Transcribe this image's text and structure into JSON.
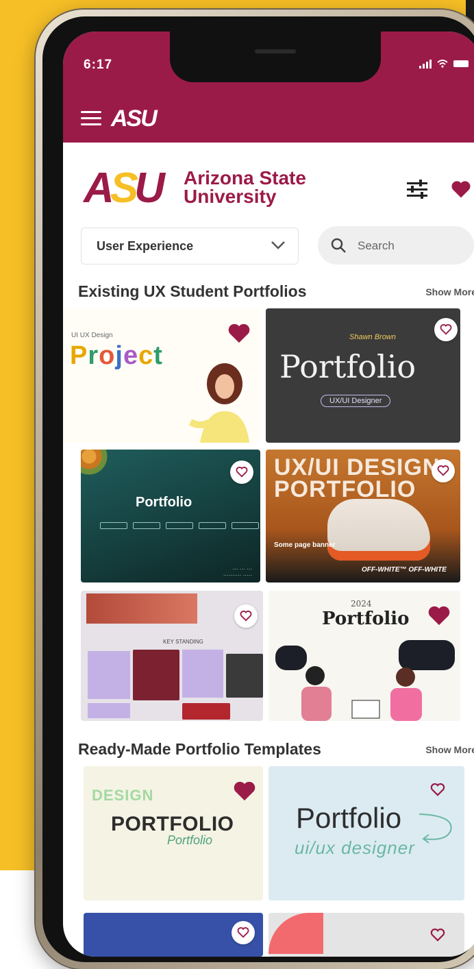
{
  "status": {
    "time": "6:17"
  },
  "appbar": {
    "logo": "ASU"
  },
  "brand": {
    "logo_asu_a": "A",
    "logo_asu_s": "S",
    "logo_asu_u": "U",
    "name_line1": "Arizona State",
    "name_line2": "University"
  },
  "controls": {
    "dropdown_value": "User Experience",
    "search_placeholder": "Search"
  },
  "sections": [
    {
      "title": "Existing UX Student Portfolios",
      "more": "Show More"
    },
    {
      "title": "Ready-Made Portfolio Templates",
      "more": "Show More"
    }
  ],
  "cards": {
    "c1": {
      "small": "UI UX Design",
      "title_letters": [
        "P",
        "r",
        "o",
        "j",
        "e",
        "c",
        "t"
      ],
      "liked": true
    },
    "c2": {
      "title": "Portfolio",
      "pill": "UX/UI Designer",
      "script": "Shawn Brown",
      "liked": false
    },
    "c3": {
      "title": "Portfolio",
      "liked": false
    },
    "c4": {
      "title_line1": "UX/UI DESIGN",
      "title_line2": "PORTFOLIO",
      "caption": "Some page banner",
      "strip": "OFF-WHITE™ OFF-WHITE",
      "liked": false
    },
    "c5": {
      "label": "KEY STANDING",
      "liked": false
    },
    "c6": {
      "year": "2024",
      "title": "Portfolio",
      "liked": true
    },
    "c7": {
      "ghost": "DESIGN",
      "title": "PORTFOLIO",
      "script": "Portfolio",
      "liked": true
    },
    "c8": {
      "title": "Portfolio",
      "script": "ui/ux designer",
      "liked": false
    },
    "c9": {
      "liked": false
    },
    "c10": {
      "liked": false
    }
  },
  "colors": {
    "asu_maroon": "#9b1b48",
    "asu_gold": "#f6bf26",
    "heart": "#9b1b48"
  }
}
